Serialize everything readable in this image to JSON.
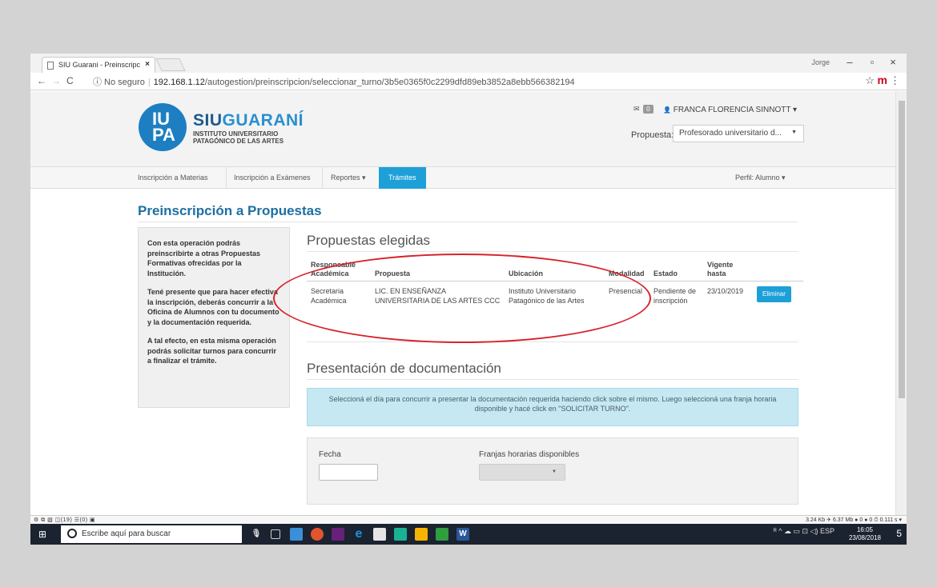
{
  "browser": {
    "tab_title": "SIU Guarani - Preinscripc",
    "tab_close": "×",
    "window_user": "Jorge",
    "win_minimize": "–",
    "win_maximize": "▫",
    "win_close": "×",
    "back": "←",
    "forward": "→",
    "reload": "C",
    "security": "ⓘ No seguro",
    "url_host": "192.168.1.12",
    "url_path": "/autogestion/preinscripcion/seleccionar_turno/3b5e0365f0c2299dfd89eb3852a8ebb566382194",
    "star": "☆",
    "ext": "m",
    "menu": "⋮"
  },
  "header": {
    "logo_mark": "IU\nPA",
    "brand_siu": "SIU",
    "brand_guarani": "GUARANÍ",
    "institution_line1": "INSTITUTO UNIVERSITARIO",
    "institution_line2": "PATAGÓNICO DE LAS ARTES",
    "messages_icon": "✉",
    "messages_count": "0",
    "user_icon": "👤",
    "user_name": "FRANCA FLORENCIA SINNOTT ▾",
    "propuesta_label": "Propuesta:",
    "propuesta_value": "Profesorado universitario d...",
    "caret": "▼"
  },
  "nav": {
    "items": [
      {
        "label": "Inscripción a Materias"
      },
      {
        "label": "Inscripción a Exámenes"
      },
      {
        "label": "Reportes ▾"
      },
      {
        "label": "Trámites"
      }
    ],
    "perfil": "Perfil: Alumno ▾"
  },
  "page": {
    "title": "Preinscripción a Propuestas",
    "info": [
      "Con esta operación podrás preinscribirte a otras Propuestas Formativas ofrecidas por la Institución.",
      "Tené presente que para hacer efectiva la inscripción, deberás concurrir a la Oficina de Alumnos con tu documento y la documentación requerida.",
      "A tal efecto, en esta misma operación podrás solicitar turnos para concurrir a finalizar el trámite."
    ]
  },
  "propuestas": {
    "title": "Propuestas elegidas",
    "headers": [
      "Responsable Académica",
      "Propuesta",
      "Ubicación",
      "Modalidad",
      "Estado",
      "Vigente hasta",
      ""
    ],
    "row": {
      "responsable": "Secretaria Académica",
      "propuesta": "LIC. EN ENSEÑANZA UNIVERSITARIA DE LAS ARTES CCC",
      "ubicacion": "Instituto Universitario Patagónico de las Artes",
      "modalidad": "Presencial",
      "estado": "Pendiente de inscripción",
      "vigente": "23/10/2019",
      "eliminar": "Eliminar"
    }
  },
  "documentacion": {
    "title": "Presentación de documentación",
    "alert": "Seleccioná el día para concurrir a presentar la documentación requerida haciendo click sobre el mismo. Luego seleccioná una franja horaria disponible y hacé click en \"SOLICITAR TURNO\".",
    "fecha_label": "Fecha",
    "franjas_label": "Franjas horarias disponibles",
    "caret": "▼"
  },
  "statusbar": {
    "left": "⚙ ⧉ ▧ ◫(19) ☰(0) ▣",
    "right": "3.24 Kb  ✈ 6.37 Mb  ● 0  ● 0  ⏱ 0.111 s ▾"
  },
  "taskbar": {
    "search_placeholder": "Escribe aquí para buscar",
    "tray": "ᴿ  ^ ☁ ▭ ⊡ ◁) ESP",
    "time": "16:05",
    "date": "23/08/2018",
    "notifications": "5"
  },
  "colors": {
    "accent": "#1da0d8",
    "title_blue": "#1d6fa0",
    "annotation_red": "#d6232a",
    "alert_bg": "#c6e8f3"
  }
}
